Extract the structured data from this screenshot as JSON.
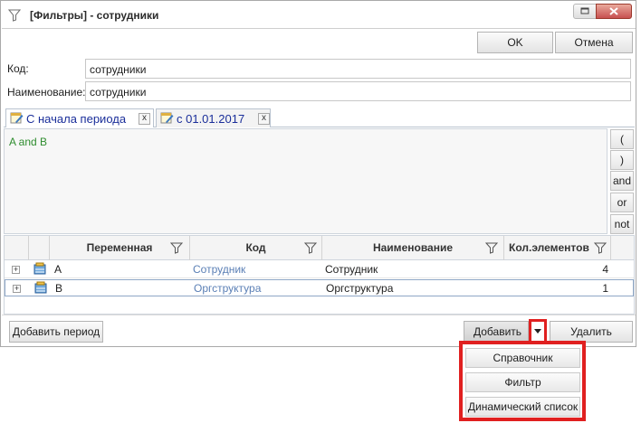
{
  "window": {
    "title": "[Фильтры] - сотрудники",
    "title_icon": "filter-icon"
  },
  "toolbar": {
    "ok_label": "OK",
    "cancel_label": "Отмена"
  },
  "form": {
    "code_label": "Код:",
    "code_value": "сотрудники",
    "name_label": "Наименование:",
    "name_value": "сотрудники"
  },
  "tabs": [
    {
      "label": "С начала периода",
      "close": "x",
      "icon": "calendar-edit-icon",
      "active": true
    },
    {
      "label": "с 01.01.2017",
      "close": "x",
      "icon": "calendar-edit-icon",
      "active": false
    }
  ],
  "expression": {
    "text": "A and B",
    "color": "#2f8d2f"
  },
  "operators": [
    "(",
    ")",
    "and",
    "or",
    "not"
  ],
  "grid": {
    "columns": [
      "Переменная",
      "Код",
      "Наименование",
      "Кол.элементов"
    ],
    "rows": [
      {
        "variable": "A",
        "code": "Сотрудник",
        "name": "Сотрудник",
        "count": "4"
      },
      {
        "variable": "B",
        "code": "Оргструктура",
        "name": "Оргструктура",
        "count": "1"
      }
    ],
    "link_color": "#5a7fb5"
  },
  "footer": {
    "add_period_label": "Добавить период",
    "add_label": "Добавить",
    "delete_label": "Удалить"
  },
  "dropdown": {
    "items": [
      "Справочник",
      "Фильтр",
      "Динамический список"
    ]
  },
  "highlight_color": "#e02020"
}
